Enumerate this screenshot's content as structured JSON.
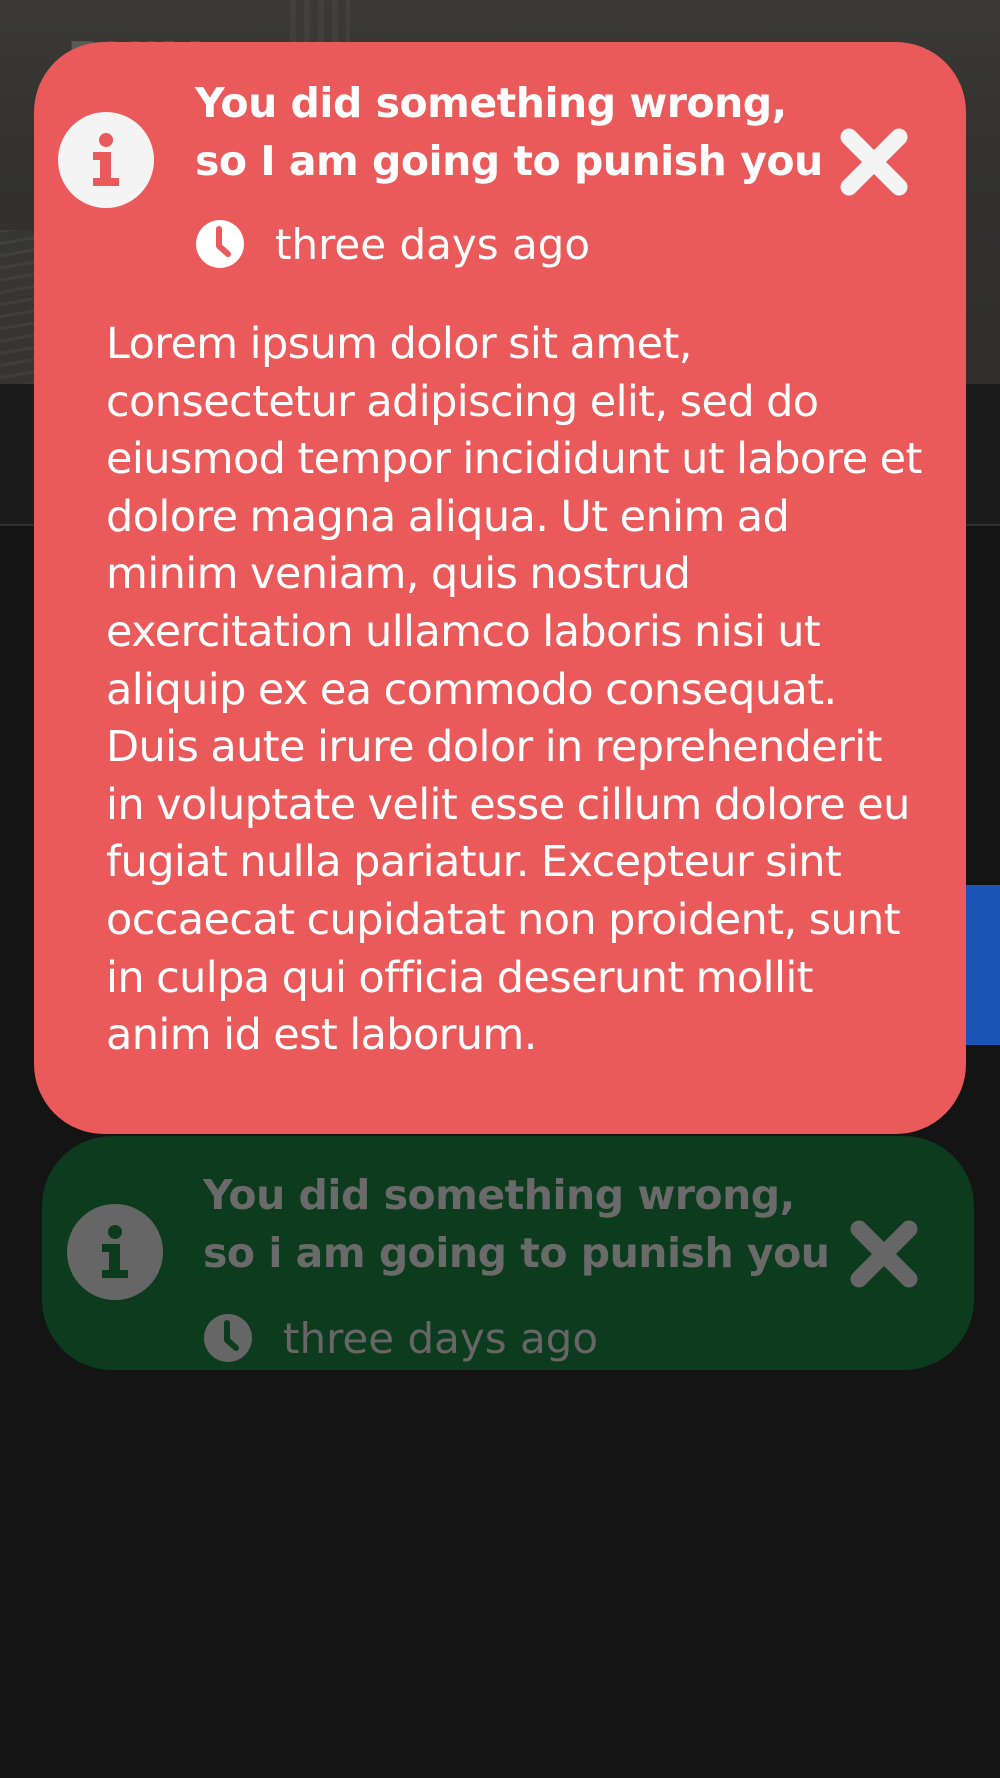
{
  "background": {
    "brand_text": "PUIM",
    "accent_pill_color": "#1d5fd1"
  },
  "toasts": [
    {
      "variant": "error",
      "color": "#eb5a5a",
      "icon": "info-icon",
      "title": "You did something wrong, so I am going to punish you",
      "time_icon": "clock-icon",
      "time": "three days ago",
      "close_icon": "close-icon",
      "body": "Lorem ipsum dolor sit amet, consectetur adipiscing elit, sed do eiusmod tempor incididunt ut labore et dolore magna aliqua. Ut enim ad minim veniam, quis nostrud exercitation ullamco laboris nisi ut aliquip ex ea commodo consequat. Duis aute irure dolor in reprehenderit in voluptate velit esse cillum dolore eu fugiat nulla pariatur. Excepteur sint occaecat cupidatat non proident, sunt in culpa qui officia deserunt mollit anim id est laborum."
    },
    {
      "variant": "success",
      "color": "#0d3b1e",
      "icon": "info-icon",
      "title": "You did something wrong, so i am going to punish you",
      "time_icon": "clock-icon",
      "time": "three days ago",
      "close_icon": "close-icon"
    }
  ]
}
